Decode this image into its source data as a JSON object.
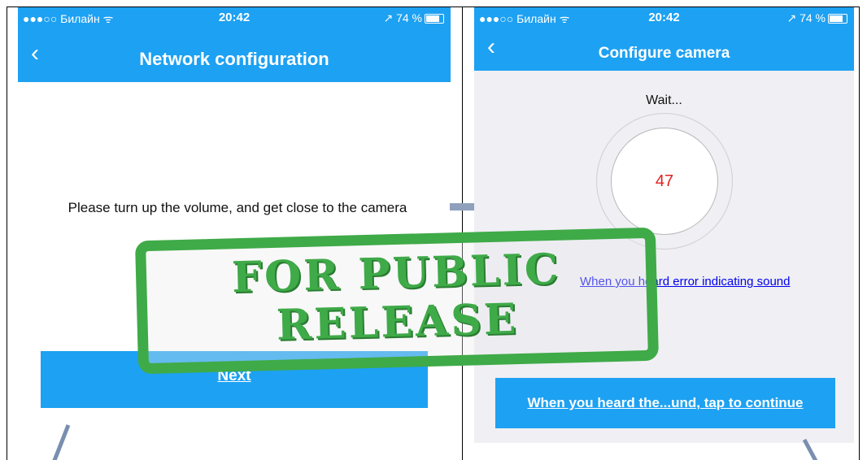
{
  "left_screen": {
    "status": {
      "carrier": "●●●○○ Билайн ᯤ",
      "time": "20:42",
      "battery": "↗ 74 %"
    },
    "nav": {
      "back_icon": "chevron-left-icon",
      "back_glyph": "‹",
      "title": "Network configuration"
    },
    "message": "Please turn up the volume, and get close to the camera",
    "next_button": "Next"
  },
  "right_screen": {
    "status": {
      "carrier": "●●●○○ Билайн ᯤ",
      "time": "20:42",
      "battery": "↗ 74 %"
    },
    "nav": {
      "back_icon": "chevron-left-icon",
      "back_glyph": "‹",
      "title": "Configure camera"
    },
    "wait_text": "Wait...",
    "countdown": "47",
    "error_link": "When you heard error indicating sound",
    "continue_button": "When you heard the...und, tap to continue"
  },
  "stamp": {
    "line1": "FOR PUBLIC",
    "line2": "RELEASE"
  },
  "colors": {
    "accent": "#1da1f2",
    "stamp_green": "#3faa48",
    "countdown_red": "#e02020",
    "link_blue": "#0000ee"
  }
}
